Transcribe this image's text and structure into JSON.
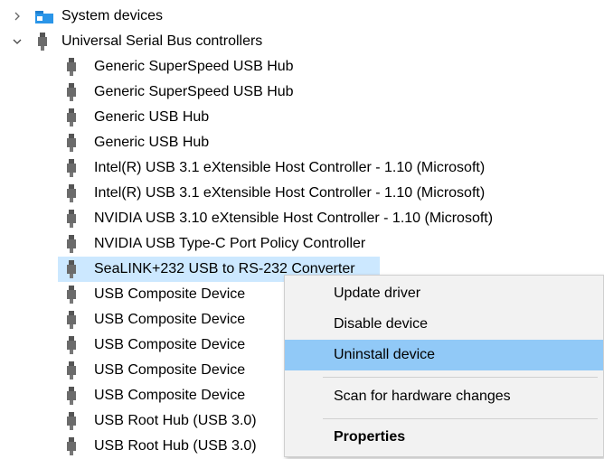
{
  "tree": {
    "system_devices": "System devices",
    "usb_controllers": "Universal Serial Bus controllers",
    "items": [
      "Generic SuperSpeed USB Hub",
      "Generic SuperSpeed USB Hub",
      "Generic USB Hub",
      "Generic USB Hub",
      "Intel(R) USB 3.1 eXtensible Host Controller - 1.10 (Microsoft)",
      "Intel(R) USB 3.1 eXtensible Host Controller - 1.10 (Microsoft)",
      "NVIDIA USB 3.10 eXtensible Host Controller - 1.10 (Microsoft)",
      "NVIDIA USB Type-C Port Policy Controller",
      "SeaLINK+232 USB to RS-232 Converter",
      "USB Composite Device",
      "USB Composite Device",
      "USB Composite Device",
      "USB Composite Device",
      "USB Composite Device",
      "USB Root Hub (USB 3.0)",
      "USB Root Hub (USB 3.0)"
    ]
  },
  "context_menu": {
    "update_driver": "Update driver",
    "disable_device": "Disable device",
    "uninstall_device": "Uninstall device",
    "scan_hardware": "Scan for hardware changes",
    "properties": "Properties"
  },
  "colors": {
    "selection": "#cce8ff",
    "menu_hover": "#91c9f7",
    "menu_bg": "#f2f2f2"
  },
  "icons": {
    "expand_collapsed": "chevron-right-icon",
    "expand_open": "chevron-down-icon",
    "system_devices": "system-devices-folder-icon",
    "usb": "usb-plug-icon"
  }
}
